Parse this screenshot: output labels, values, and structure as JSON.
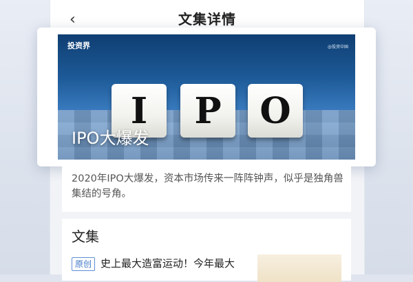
{
  "header": {
    "back_icon": "chevron-left-icon",
    "title": "文集详情"
  },
  "cover": {
    "logo": "投资界",
    "watermark": "@投资中国",
    "tiles": [
      "I",
      "P",
      "O"
    ],
    "title": "IPO大爆发"
  },
  "description": "2020年IPO大爆发，资本市场传来一阵阵钟声，似乎是独角兽集结的号角。",
  "collection": {
    "section_title": "文集",
    "items": [
      {
        "badge": "原创",
        "title": "史上最大造富运动！今年最大"
      }
    ]
  },
  "colors": {
    "badge": "#3f77c8",
    "cover_blue": "#1d5a98"
  }
}
